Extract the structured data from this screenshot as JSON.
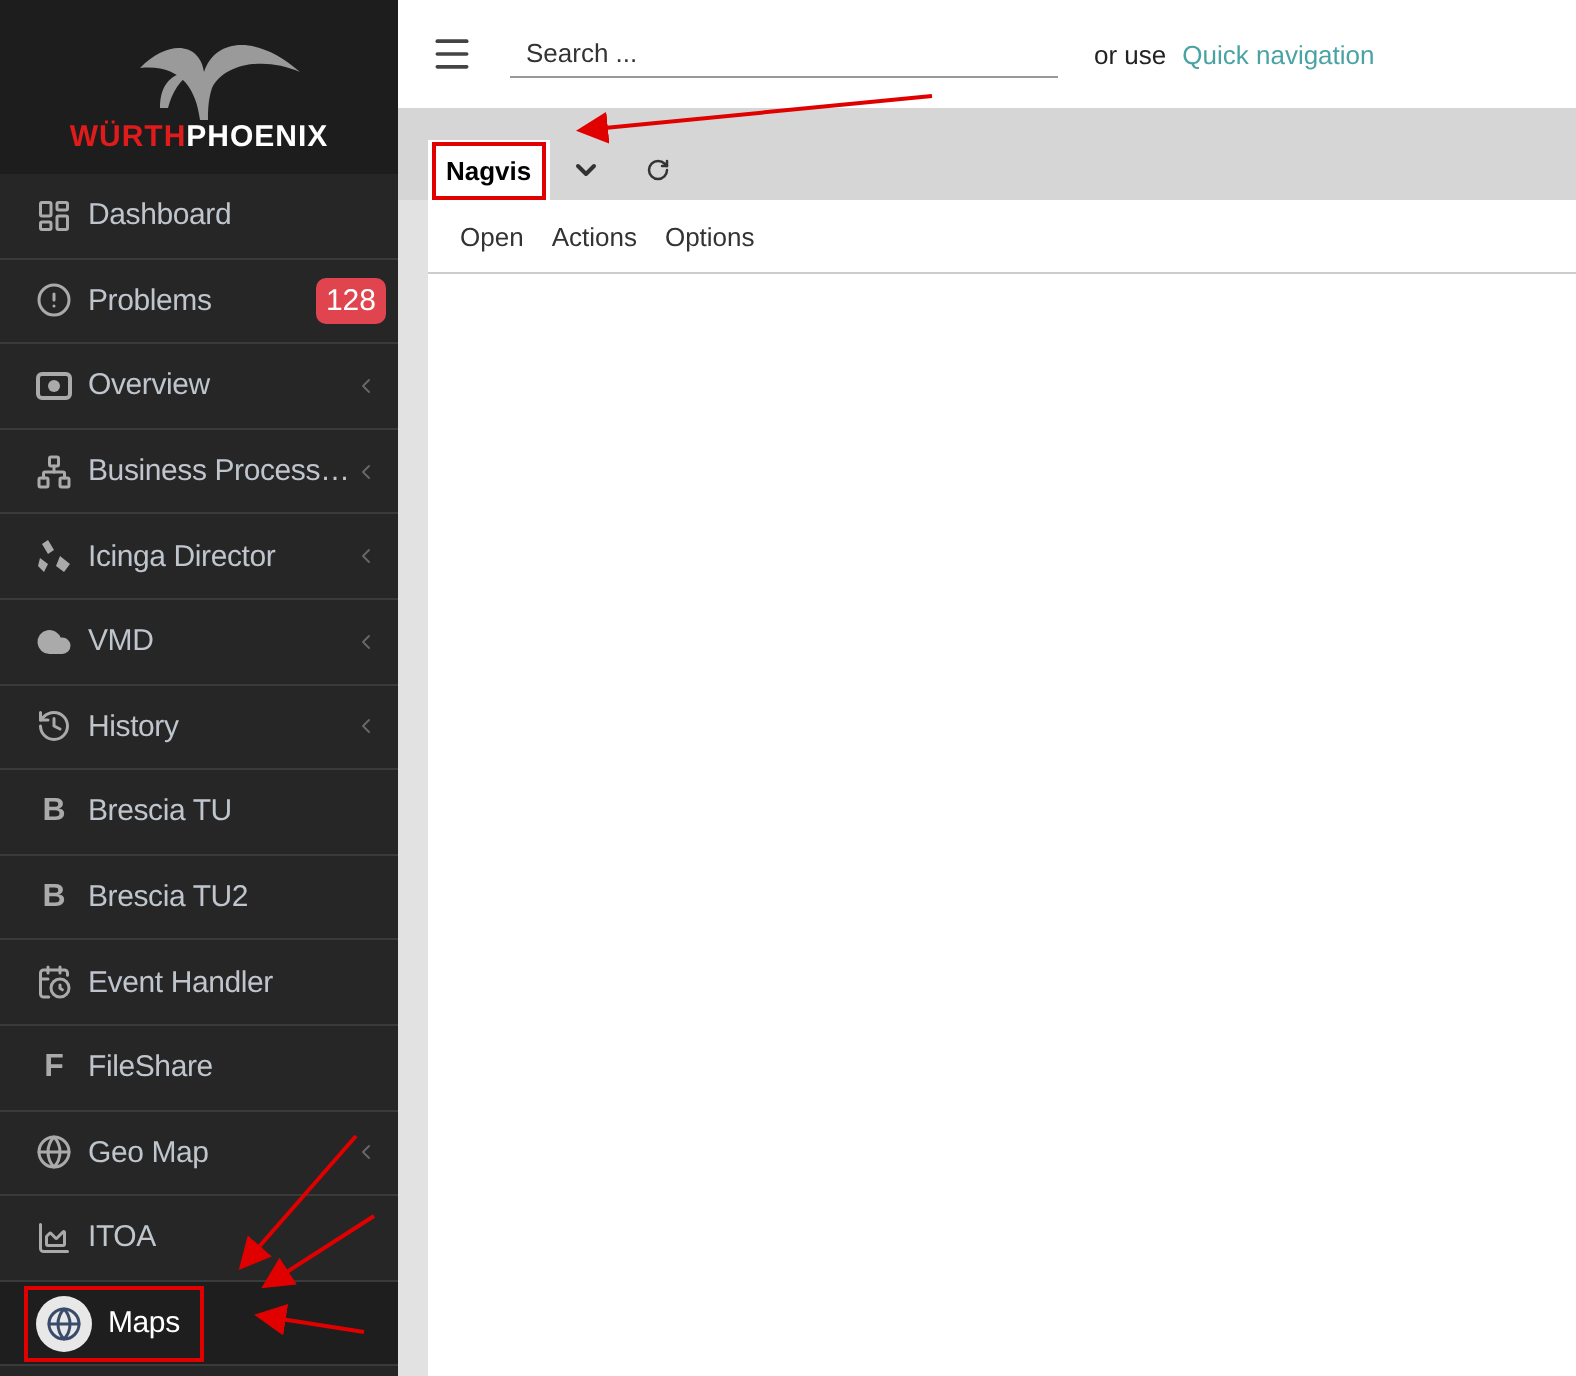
{
  "logo": {
    "brand_first": "WÜRTH",
    "brand_second": "PHOENIX"
  },
  "sidebar": {
    "items": [
      {
        "label": "Dashboard",
        "kind": "dashboard",
        "expandable": false,
        "selected": false,
        "highlighted": false
      },
      {
        "label": "Problems",
        "kind": "alert",
        "badge": "128",
        "expandable": false,
        "selected": false,
        "highlighted": false
      },
      {
        "label": "Overview",
        "kind": "overview",
        "expandable": true,
        "selected": false,
        "highlighted": false
      },
      {
        "label": "Business Process…",
        "kind": "network",
        "expandable": true,
        "selected": false,
        "highlighted": false
      },
      {
        "label": "Icinga Director",
        "kind": "director",
        "expandable": true,
        "selected": false,
        "highlighted": false
      },
      {
        "label": "VMD",
        "kind": "cloud",
        "expandable": true,
        "selected": false,
        "highlighted": false
      },
      {
        "label": "History",
        "kind": "history",
        "expandable": true,
        "selected": false,
        "highlighted": false
      },
      {
        "label": "Brescia TU",
        "kind": "letter",
        "glyph": "B",
        "expandable": false,
        "selected": false,
        "highlighted": false
      },
      {
        "label": "Brescia TU2",
        "kind": "letter",
        "glyph": "B",
        "expandable": false,
        "selected": false,
        "highlighted": false
      },
      {
        "label": "Event Handler",
        "kind": "calendar",
        "expandable": false,
        "selected": false,
        "highlighted": false
      },
      {
        "label": "FileShare",
        "kind": "letter",
        "glyph": "F",
        "expandable": false,
        "selected": false,
        "highlighted": false
      },
      {
        "label": "Geo Map",
        "kind": "globe",
        "expandable": true,
        "selected": false,
        "highlighted": false
      },
      {
        "label": "ITOA",
        "kind": "chart",
        "expandable": false,
        "selected": false,
        "highlighted": false
      },
      {
        "label": "Maps",
        "kind": "globe",
        "expandable": false,
        "selected": true,
        "highlighted": true
      }
    ]
  },
  "header": {
    "search": {
      "placeholder": "Search ..."
    },
    "alt_text": "or use",
    "quick_link": "Quick navigation"
  },
  "tabs": [
    {
      "label": "Nagvis",
      "selected": true,
      "highlighted": true
    }
  ],
  "actions": [
    "Open",
    "Actions",
    "Options"
  ]
}
